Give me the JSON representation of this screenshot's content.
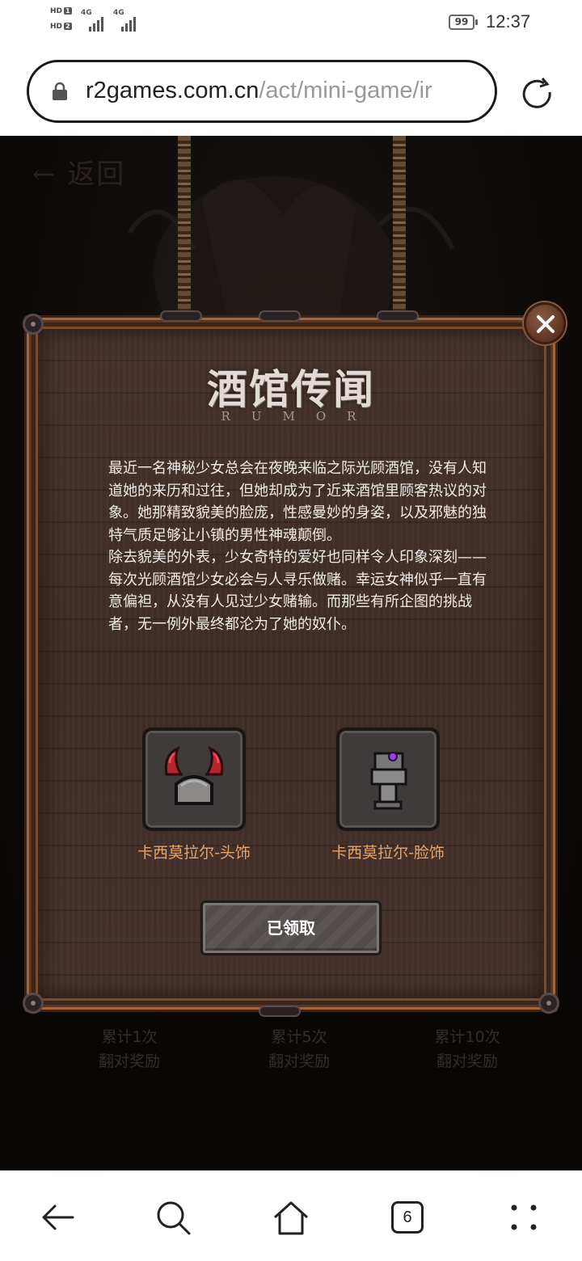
{
  "status_bar": {
    "sim1": "HD",
    "sim1_slot": "1",
    "sim2": "HD",
    "sim2_slot": "2",
    "net1": "4G",
    "net2": "4G",
    "battery": "99",
    "time": "12:37"
  },
  "browser": {
    "url_host": "r2games.com.cn",
    "url_path": "/act/mini-game/ir",
    "tab_count": "6"
  },
  "page": {
    "back_label": "返回",
    "bottom_rewards": [
      {
        "line1": "累计1次",
        "line2": "翻对奖励"
      },
      {
        "line1": "累计5次",
        "line2": "翻对奖励"
      },
      {
        "line1": "累计10次",
        "line2": "翻对奖励"
      }
    ]
  },
  "modal": {
    "title": "酒馆传闻",
    "subtitle": "RUMOR",
    "paragraph1": "最近一名神秘少女总会在夜晚来临之际光顾酒馆，没有人知道她的来历和过往，但她却成为了近来酒馆里顾客热议的对象。她那精致貌美的脸庞，性感曼妙的身姿，以及邪魅的独特气质足够让小镇的男性神魂颠倒。",
    "paragraph2": "除去貌美的外表，少女奇特的爱好也同样令人印象深刻——每次光顾酒馆少女必会与人寻乐做赌。幸运女神似乎一直有意偏袒，从没有人见过少女赌输。而那些有所企图的挑战者，无一例外最终都沦为了她的奴仆。",
    "rewards": [
      {
        "name": "卡西莫拉尔-头饰",
        "icon": "horned-helmet-icon"
      },
      {
        "name": "卡西莫拉尔-脸饰",
        "icon": "face-ornament-icon"
      }
    ],
    "claim_button": "已领取"
  },
  "colors": {
    "item_label": "#e8a36a",
    "board": "#3f2d26",
    "frame": "#7a4a2e"
  }
}
